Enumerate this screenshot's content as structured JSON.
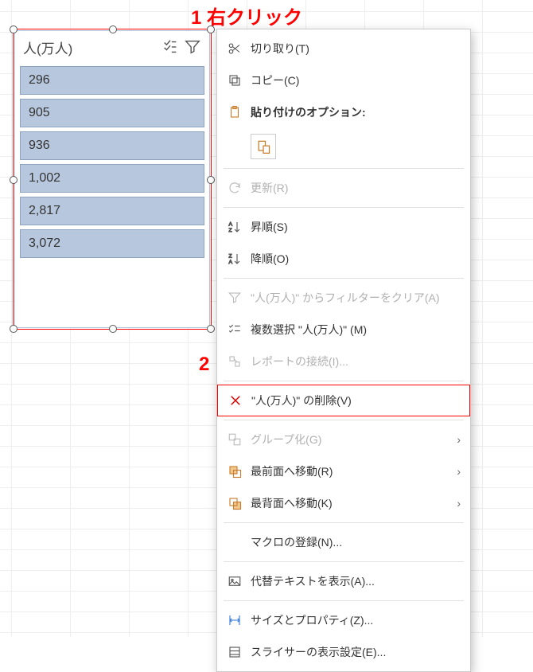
{
  "annotations": {
    "step1": "1 右クリック",
    "step2": "2"
  },
  "slicer": {
    "title": "人(万人)",
    "items": [
      "296",
      "905",
      "936",
      "1,002",
      "2,817",
      "3,072"
    ]
  },
  "menu": {
    "cut": "切り取り(T)",
    "copy": "コピー(C)",
    "pasteOptions": "貼り付けのオプション:",
    "refresh": "更新(R)",
    "sortAsc": "昇順(S)",
    "sortDesc": "降順(O)",
    "clearFilter": "\"人(万人)\" からフィルターをクリア(A)",
    "multiSelect": "複数選択 \"人(万人)\" (M)",
    "reportConn": "レポートの接続(I)...",
    "delete": "\"人(万人)\" の削除(V)",
    "group": "グループ化(G)",
    "bringFront": "最前面へ移動(R)",
    "sendBack": "最背面へ移動(K)",
    "macro": "マクロの登録(N)...",
    "altText": "代替テキストを表示(A)...",
    "sizeProps": "サイズとプロパティ(Z)...",
    "slicerSettings": "スライサーの表示設定(E)..."
  }
}
